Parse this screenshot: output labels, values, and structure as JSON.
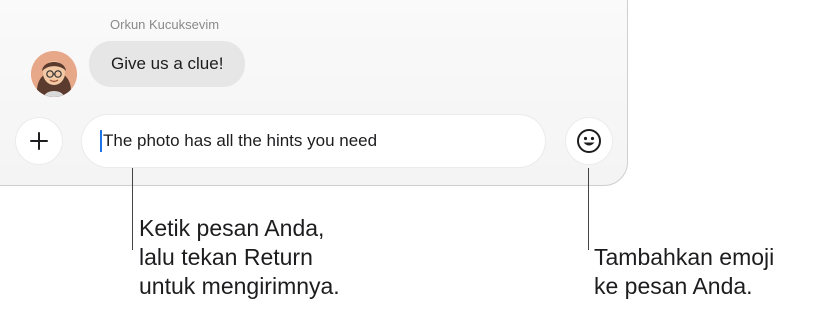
{
  "chat": {
    "sender_name": "Orkun Kucuksevim",
    "message": "Give us a clue!"
  },
  "composer": {
    "add_button_icon": "plus-icon",
    "input_value": "The photo has all the hints you need",
    "emoji_button_icon": "smiley-icon"
  },
  "callouts": {
    "input": {
      "lines": [
        "Ketik pesan Anda,",
        "lalu tekan Return",
        "untuk mengirimnya."
      ]
    },
    "emoji": {
      "lines": [
        "Tambahkan emoji",
        "ke pesan Anda."
      ]
    }
  },
  "colors": {
    "caret": "#1e73e8",
    "bubble": "#e6e6e6",
    "avatar_bg": "#e7a88a"
  }
}
